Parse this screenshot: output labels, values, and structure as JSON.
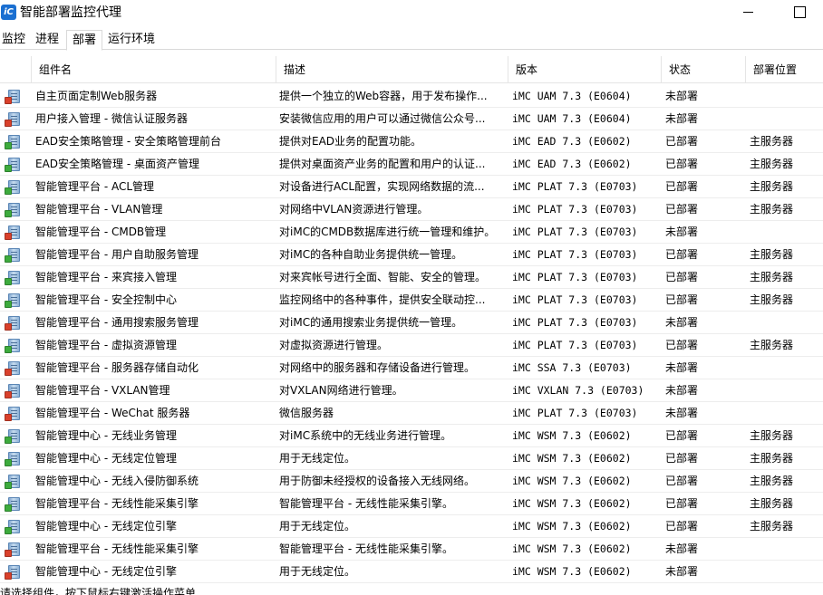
{
  "window": {
    "title": "智能部署监控代理",
    "logo_text": "iC"
  },
  "tabs": [
    {
      "label": "监控"
    },
    {
      "label": "进程"
    },
    {
      "label": "部署"
    },
    {
      "label": "运行环境"
    }
  ],
  "table": {
    "columns": [
      "组件名",
      "描述",
      "版本",
      "状态",
      "部署位置"
    ],
    "rows": [
      {
        "icon": "server-not-deployed-icon",
        "name": "自主页面定制Web服务器",
        "desc": "提供一个独立的Web容器，用于发布操作...",
        "version": "iMC UAM 7.3 (E0604)",
        "status": "未部署",
        "location": ""
      },
      {
        "icon": "server-not-deployed-icon",
        "name": "用户接入管理 - 微信认证服务器",
        "desc": "安装微信应用的用户可以通过微信公众号...",
        "version": "iMC UAM 7.3 (E0604)",
        "status": "未部署",
        "location": ""
      },
      {
        "icon": "server-deployed-icon",
        "name": "EAD安全策略管理 - 安全策略管理前台",
        "desc": "提供对EAD业务的配置功能。",
        "version": "iMC EAD 7.3 (E0602)",
        "status": "已部署",
        "location": "主服务器"
      },
      {
        "icon": "server-deployed-icon",
        "name": "EAD安全策略管理 - 桌面资产管理",
        "desc": "提供对桌面资产业务的配置和用户的认证...",
        "version": "iMC EAD 7.3 (E0602)",
        "status": "已部署",
        "location": "主服务器"
      },
      {
        "icon": "server-deployed-icon",
        "name": "智能管理平台 - ACL管理",
        "desc": "对设备进行ACL配置，实现网络数据的流...",
        "version": "iMC PLAT 7.3 (E0703)",
        "status": "已部署",
        "location": "主服务器"
      },
      {
        "icon": "server-deployed-icon",
        "name": "智能管理平台 - VLAN管理",
        "desc": "对网络中VLAN资源进行管理。",
        "version": "iMC PLAT 7.3 (E0703)",
        "status": "已部署",
        "location": "主服务器"
      },
      {
        "icon": "server-not-deployed-icon",
        "name": "智能管理平台 - CMDB管理",
        "desc": "对iMC的CMDB数据库进行统一管理和维护。",
        "version": "iMC PLAT 7.3 (E0703)",
        "status": "未部署",
        "location": ""
      },
      {
        "icon": "server-deployed-icon",
        "name": "智能管理平台 - 用户自助服务管理",
        "desc": "对iMC的各种自助业务提供统一管理。",
        "version": "iMC PLAT 7.3 (E0703)",
        "status": "已部署",
        "location": "主服务器"
      },
      {
        "icon": "server-deployed-icon",
        "name": "智能管理平台 - 来宾接入管理",
        "desc": "对来宾帐号进行全面、智能、安全的管理。",
        "version": "iMC PLAT 7.3 (E0703)",
        "status": "已部署",
        "location": "主服务器"
      },
      {
        "icon": "server-deployed-icon",
        "name": "智能管理平台 - 安全控制中心",
        "desc": "监控网络中的各种事件，提供安全联动控...",
        "version": "iMC PLAT 7.3 (E0703)",
        "status": "已部署",
        "location": "主服务器"
      },
      {
        "icon": "server-not-deployed-icon",
        "name": "智能管理平台 - 通用搜索服务管理",
        "desc": "对iMC的通用搜索业务提供统一管理。",
        "version": "iMC PLAT 7.3 (E0703)",
        "status": "未部署",
        "location": ""
      },
      {
        "icon": "server-deployed-icon",
        "name": "智能管理平台 - 虚拟资源管理",
        "desc": "对虚拟资源进行管理。",
        "version": "iMC PLAT 7.3 (E0703)",
        "status": "已部署",
        "location": "主服务器"
      },
      {
        "icon": "server-not-deployed-icon",
        "name": "智能管理平台 - 服务器存储自动化",
        "desc": "对网络中的服务器和存储设备进行管理。",
        "version": "iMC SSA 7.3 (E0703)",
        "status": "未部署",
        "location": ""
      },
      {
        "icon": "server-not-deployed-icon",
        "name": "智能管理平台 - VXLAN管理",
        "desc": "对VXLAN网络进行管理。",
        "version": "iMC VXLAN 7.3 (E0703)",
        "status": "未部署",
        "location": ""
      },
      {
        "icon": "server-not-deployed-icon",
        "name": "智能管理平台 - WeChat 服务器",
        "desc": "微信服务器",
        "version": "iMC PLAT 7.3 (E0703)",
        "status": "未部署",
        "location": ""
      },
      {
        "icon": "server-deployed-icon",
        "name": "智能管理中心 - 无线业务管理",
        "desc": "对iMC系统中的无线业务进行管理。",
        "version": "iMC WSM 7.3 (E0602)",
        "status": "已部署",
        "location": "主服务器"
      },
      {
        "icon": "server-deployed-icon",
        "name": "智能管理中心 - 无线定位管理",
        "desc": "用于无线定位。",
        "version": "iMC WSM 7.3 (E0602)",
        "status": "已部署",
        "location": "主服务器"
      },
      {
        "icon": "server-deployed-icon",
        "name": "智能管理中心 - 无线入侵防御系统",
        "desc": "用于防御未经授权的设备接入无线网络。",
        "version": "iMC WSM 7.3 (E0602)",
        "status": "已部署",
        "location": "主服务器"
      },
      {
        "icon": "server-deployed-icon",
        "name": "智能管理平台 - 无线性能采集引擎",
        "desc": "智能管理平台 - 无线性能采集引擎。",
        "version": "iMC WSM 7.3 (E0602)",
        "status": "已部署",
        "location": "主服务器"
      },
      {
        "icon": "server-deployed-icon",
        "name": "智能管理中心 - 无线定位引擎",
        "desc": "用于无线定位。",
        "version": "iMC WSM 7.3 (E0602)",
        "status": "已部署",
        "location": "主服务器"
      },
      {
        "icon": "server-not-deployed-icon",
        "name": "智能管理平台 - 无线性能采集引擎",
        "desc": "智能管理平台 - 无线性能采集引擎。",
        "version": "iMC WSM 7.3 (E0602)",
        "status": "未部署",
        "location": ""
      },
      {
        "icon": "server-not-deployed-icon",
        "name": "智能管理中心 - 无线定位引擎",
        "desc": "用于无线定位。",
        "version": "iMC WSM 7.3 (E0602)",
        "status": "未部署",
        "location": ""
      }
    ]
  },
  "statusbar": {
    "text": "请选择组件，按下鼠标右键激活操作菜单"
  },
  "colors": {
    "deployed": "#3dab3d",
    "not_deployed": "#d9402b",
    "logo": "#1a6fd1"
  }
}
